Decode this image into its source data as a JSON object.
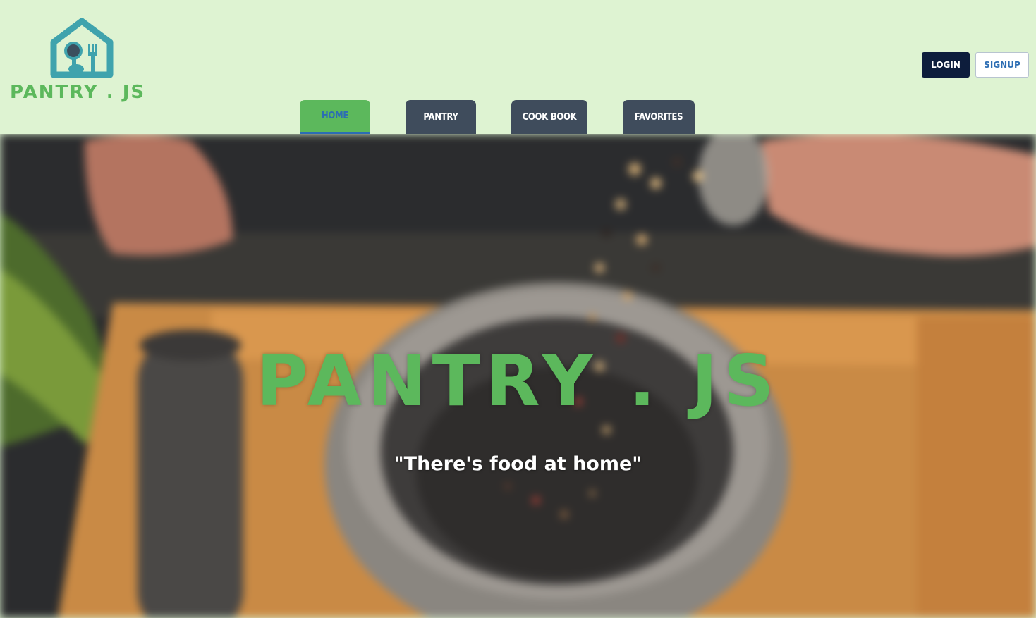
{
  "brand": {
    "logo_text": "PANTRY . JS",
    "logo_icon": "house-with-plate-and-fork-icon",
    "accent_color": "#5cb85c"
  },
  "auth": {
    "login_label": "LOGIN",
    "signup_label": "SIGNUP"
  },
  "nav": {
    "tabs": [
      {
        "label": "HOME",
        "active": true
      },
      {
        "label": "PANTRY",
        "active": false
      },
      {
        "label": "COOK BOOK",
        "active": false
      },
      {
        "label": "FAVORITES",
        "active": false
      }
    ]
  },
  "hero": {
    "title": "PANTRY . JS",
    "tagline": "\"There's food at home\"",
    "background_image": "hands-pouring-peppercorns-into-mortar-photo"
  },
  "colors": {
    "header_bg": "#def3d2",
    "active_tab": "#5cb85c",
    "inactive_tab": "#3f4c5c",
    "login_bg": "#0d1d3c",
    "link_blue": "#2c6db3"
  }
}
